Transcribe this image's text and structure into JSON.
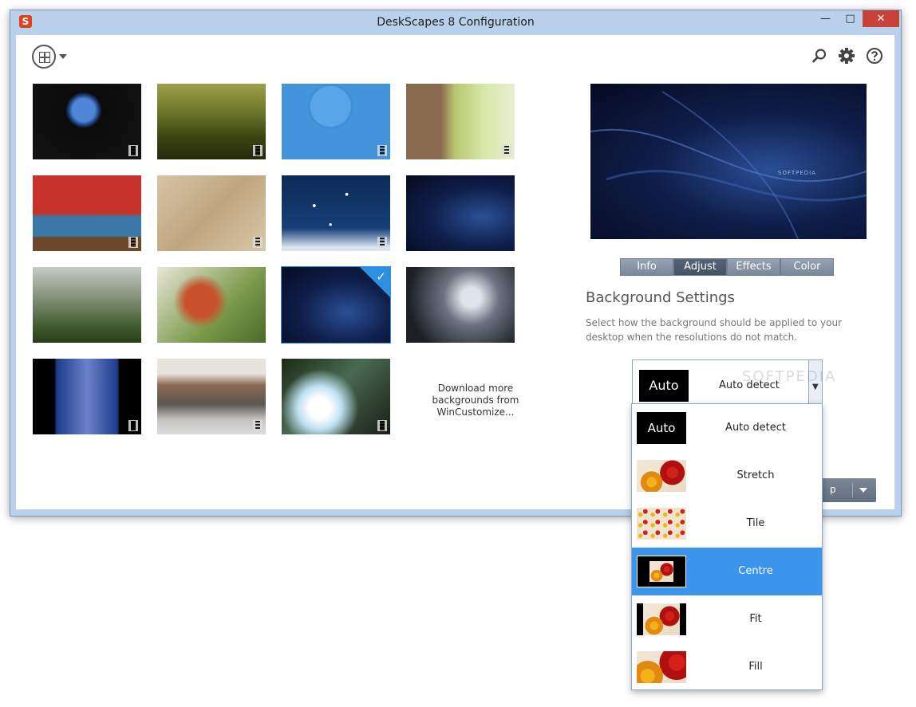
{
  "window": {
    "title": "DeskScapes 8 Configuration",
    "app_icon": "S",
    "minimize": "—",
    "maximize": "□",
    "close": "✕"
  },
  "toolbar": {
    "icons": [
      "view-switch-icon",
      "search-icon",
      "gear-icon",
      "help-icon"
    ]
  },
  "gallery": {
    "download_text": "Download more backgrounds from WinCustomize...",
    "selected_index": 10
  },
  "tabs": [
    "Info",
    "Adjust",
    "Effects",
    "Color"
  ],
  "active_tab": "Adjust",
  "settings": {
    "title": "Background Settings",
    "description": "Select how the background should be applied to your desktop when the resolutions do not match."
  },
  "combo": {
    "thumb_text": "Auto",
    "selected_label": "Auto detect"
  },
  "apply_button": {
    "partial_text": "p"
  },
  "dropdown": {
    "items": [
      {
        "label": "Auto detect",
        "thumb": "Auto"
      },
      {
        "label": "Stretch"
      },
      {
        "label": "Tile"
      },
      {
        "label": "Centre"
      },
      {
        "label": "Fit"
      },
      {
        "label": "Fill"
      }
    ],
    "selected": "Centre"
  },
  "colors": {
    "accent": "#3c95ed",
    "close": "#c7433a",
    "tab_active": "#4e5b6e"
  }
}
